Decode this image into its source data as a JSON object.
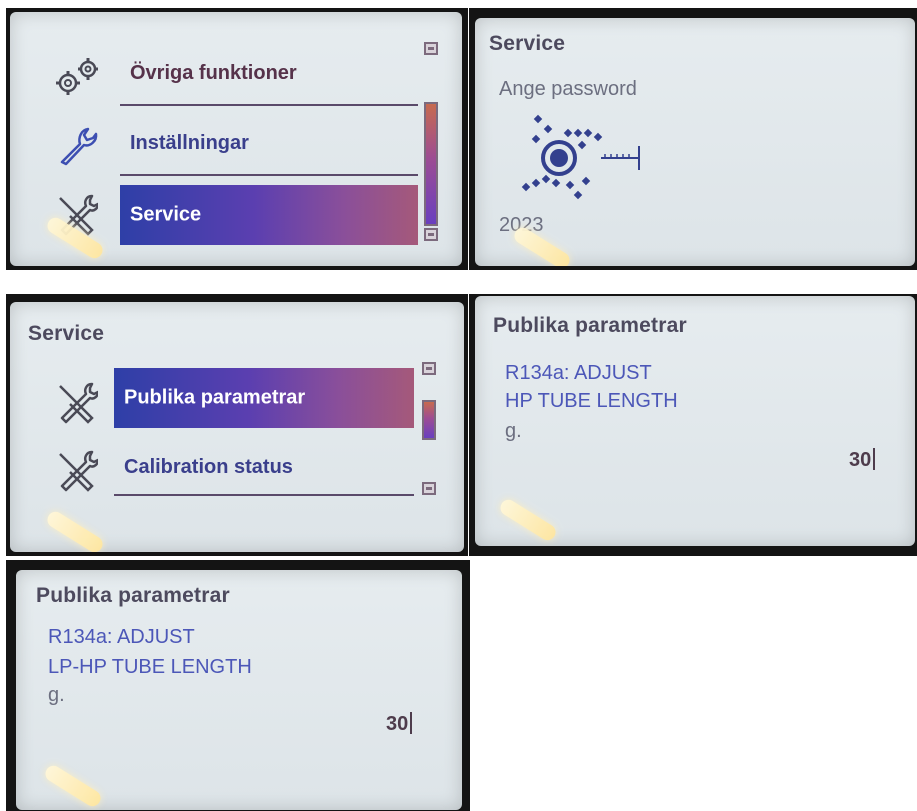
{
  "panel1": {
    "menu_items": [
      {
        "label": "Övriga funktioner",
        "icon": "gears-icon"
      },
      {
        "label": "Inställningar",
        "icon": "wrench-icon"
      },
      {
        "label": "Service",
        "icon": "service-tools-icon",
        "selected": true
      }
    ]
  },
  "panel2": {
    "title": "Service",
    "prompt": "Ange password",
    "year": "2023"
  },
  "panel3": {
    "title": "Service",
    "menu_items": [
      {
        "label": "Publika parametrar",
        "icon": "service-tools-icon",
        "selected": true
      },
      {
        "label": "Calibration status",
        "icon": "service-tools-icon"
      }
    ]
  },
  "panel4": {
    "title": "Publika parametrar",
    "line1": "R134a: ADJUST",
    "line2": "HP TUBE LENGTH",
    "unit": "g.",
    "value": "30"
  },
  "panel5": {
    "title": "Publika parametrar",
    "line1": "R134a: ADJUST",
    "line2": "LP-HP TUBE LENGTH",
    "unit": "g.",
    "value": "30"
  },
  "colors": {
    "highlight_start": "#2e3fa7",
    "highlight_end": "#a5597a",
    "menu_text": "#3a3f8c",
    "title_text": "#4d4a5e",
    "value_text": "#4e3c4c"
  }
}
